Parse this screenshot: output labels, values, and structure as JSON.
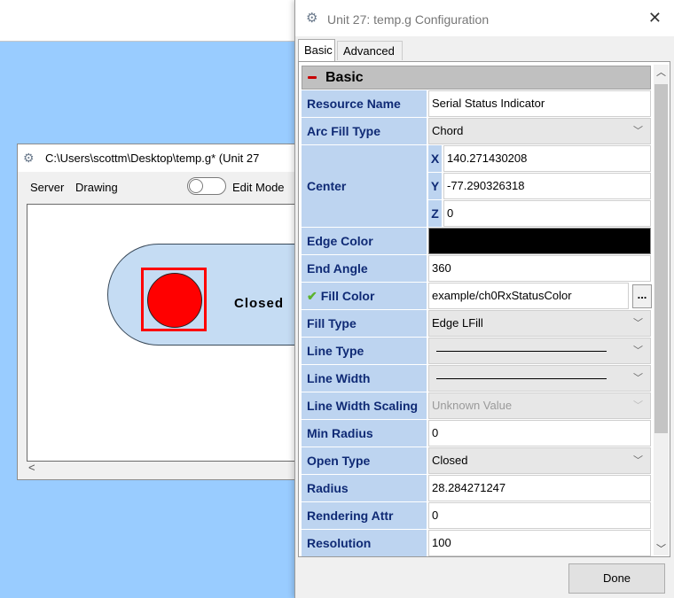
{
  "background_window": {
    "title": "C:\\Users\\scottm\\Desktop\\temp.g* (Unit 27",
    "menus": [
      "Server",
      "Drawing"
    ],
    "edit_mode_label": "Edit Mode",
    "canvas_text": "Closed"
  },
  "dialog": {
    "title": "Unit 27: temp.g Configuration",
    "close_glyph": "✕",
    "tabs": [
      "Basic",
      "Advanced"
    ],
    "section_title": "Basic",
    "properties": {
      "resource_name": {
        "label": "Resource Name",
        "value": "Serial Status Indicator"
      },
      "arc_fill_type": {
        "label": "Arc Fill Type",
        "value": "Chord"
      },
      "center": {
        "label": "Center",
        "x_label": "X",
        "x": "140.271430208",
        "y_label": "Y",
        "y": "-77.290326318",
        "z_label": "Z",
        "z": "0"
      },
      "edge_color": {
        "label": "Edge Color",
        "color": "#000000"
      },
      "end_angle": {
        "label": "End Angle",
        "value": "360"
      },
      "fill_color": {
        "label": "Fill Color",
        "value": "example/ch0RxStatusColor",
        "button": "..."
      },
      "fill_type": {
        "label": "Fill Type",
        "value": "Edge LFill"
      },
      "line_type": {
        "label": "Line Type"
      },
      "line_width": {
        "label": "Line Width"
      },
      "line_width_scaling": {
        "label": "Line Width Scaling",
        "value": "Unknown Value"
      },
      "min_radius": {
        "label": "Min Radius",
        "value": "0"
      },
      "open_type": {
        "label": "Open Type",
        "value": "Closed"
      },
      "radius": {
        "label": "Radius",
        "value": "28.284271247"
      },
      "rendering_attr": {
        "label": "Rendering Attr",
        "value": "0"
      },
      "resolution": {
        "label": "Resolution",
        "value": "100"
      }
    },
    "done_label": "Done"
  },
  "colors": {
    "desktop": "#99ccff",
    "label_bg": "#bdd4f0",
    "label_text": "#0f2a75",
    "indicator_fill": "#ff0000",
    "selection": "#ff0000"
  }
}
